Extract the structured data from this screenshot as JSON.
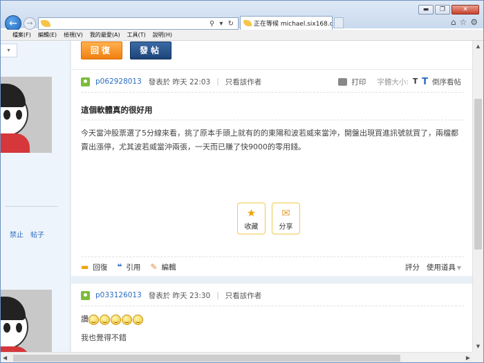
{
  "window": {
    "controls": {
      "minimize": "▬",
      "maximize": "❐",
      "close": "✕"
    }
  },
  "browser": {
    "back": "←",
    "forward": "→",
    "address_controls": "⚲ ▾ ↻",
    "tab": {
      "title": "正在等候 michael.six168.c...",
      "close": "×"
    },
    "icons": {
      "home": "⌂",
      "favorites": "☆",
      "tools": "⚙"
    }
  },
  "menubar": {
    "items": [
      "檔案(F)",
      "編輯(E)",
      "檢視(V)",
      "我的最愛(A)",
      "工具(T)",
      "說明(H)"
    ]
  },
  "page": {
    "left_dropdown": "▾",
    "left_links": [
      "禁止",
      "帖子"
    ],
    "buttons": {
      "reply": "回復",
      "post": "發帖"
    },
    "post1": {
      "username": "p062928013",
      "posted_on": "發表於 昨天 22:03",
      "divider": "|",
      "only_author": "只看該作者",
      "print": "打印",
      "font_size_label": "字體大小:",
      "font_small": "T",
      "font_large": "T",
      "reverse": "倒序看帖",
      "title": "這個軟體真的很好用",
      "body": "今天當沖股票選了5分線來看，挑了原本手頭上就有的的東陽和波若威來當沖，開盤出現買進訊號就買了，兩檔都賣出漲停，尤其波若威當沖兩張，一天而已賺了快9000的零用錢。",
      "actions": {
        "favorite": "收藏",
        "share": "分享"
      },
      "footer": {
        "reply": "回復",
        "quote": "引用",
        "edit": "編輯",
        "rate": "評分",
        "tools": "使用道具"
      }
    },
    "post2": {
      "username": "p033126013",
      "posted_on": "發表於 昨天 23:30",
      "divider": "|",
      "only_author": "只看該作者",
      "body_prefix": "讚",
      "body_line2": "我也覺得不錯"
    }
  },
  "scrollbars": {
    "up": "▲",
    "down": "▼",
    "left": "◀",
    "right": "▶"
  },
  "colors": {
    "accent_blue": "#2a6cc0",
    "reply_orange": "#f07f10",
    "post_navy": "#1c4479",
    "user_green": "#7dbb3a"
  }
}
